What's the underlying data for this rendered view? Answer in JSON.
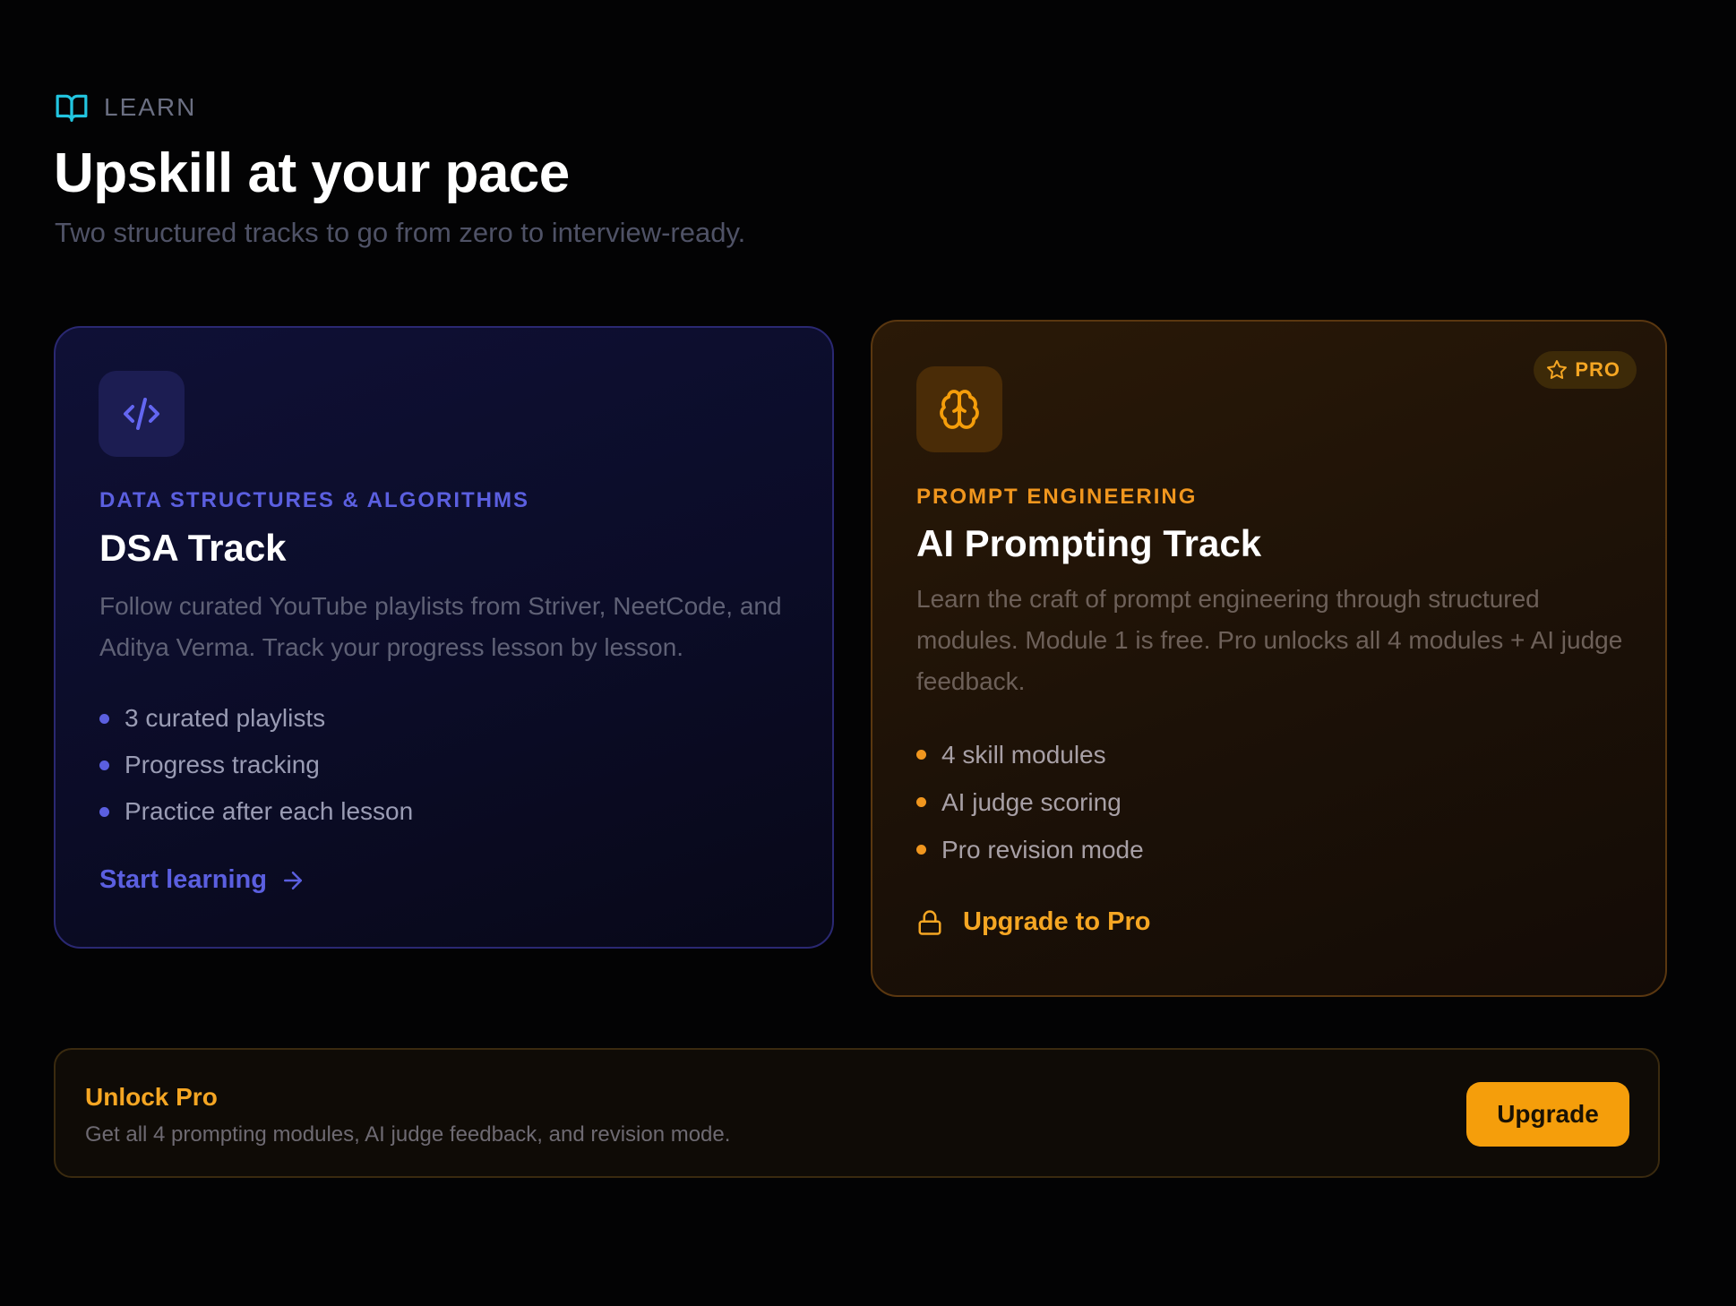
{
  "header": {
    "eyebrow_icon": "book-open-icon",
    "eyebrow": "LEARN",
    "title": "Upskill at your pace",
    "subtitle": "Two structured tracks to go from zero to interview-ready."
  },
  "tracks": [
    {
      "icon": "code-icon",
      "kicker": "DATA STRUCTURES & ALGORITHMS",
      "title": "DSA Track",
      "description": "Follow curated YouTube playlists from Striver, NeetCode, and Aditya Verma. Track your progress lesson by lesson.",
      "features": [
        "3 curated playlists",
        "Progress tracking",
        "Practice after each lesson"
      ],
      "cta": "Start learning",
      "cta_icon": "arrow-right-icon",
      "accent": "#5b5fe0"
    },
    {
      "icon": "brain-icon",
      "badge": "PRO",
      "badge_icon": "star-icon",
      "kicker": "PROMPT ENGINEERING",
      "title": "AI Prompting Track",
      "description": "Learn the craft of prompt engineering through structured modules. Module 1 is free. Pro unlocks all 4 modules + AI judge feedback.",
      "features": [
        "4 skill modules",
        "AI judge scoring",
        "Pro revision mode"
      ],
      "cta": "Upgrade to Pro",
      "cta_icon": "lock-icon",
      "accent": "#f5a623"
    }
  ],
  "banner": {
    "title": "Unlock Pro",
    "description": "Get all 4 prompting modules, AI judge feedback, and revision mode.",
    "button": "Upgrade",
    "button_color": "#f59e0b"
  },
  "colors": {
    "background": "#030304",
    "eyebrow_icon": "#22c5e0"
  }
}
